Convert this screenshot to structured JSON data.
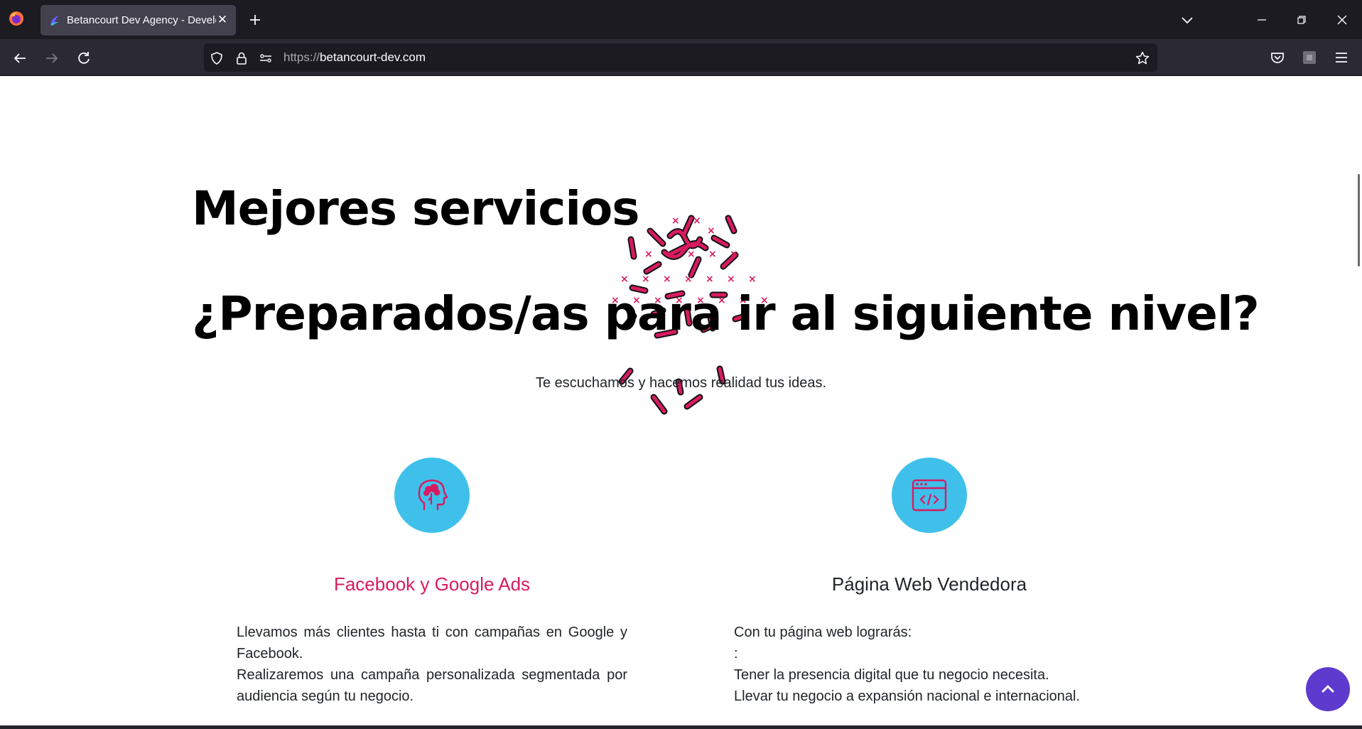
{
  "browser": {
    "tab_title": "Betancourt Dev Agency - Developers",
    "tab_close": "✕",
    "url_protocol": "https://",
    "url_host": "betancourt-dev.com"
  },
  "hero": {
    "heading_1": "Mejores servicios",
    "heading_2": "¿Preparados/as para ir al siguiente nivel?",
    "subtitle": "Te escuchamos y hacemos realidad tus ideas."
  },
  "services": [
    {
      "icon": "head-brain-icon",
      "title": "Facebook y Google Ads",
      "title_color": "#d81b60",
      "lines": [
        "Llevamos más clientes hasta ti con campañas en Google y Facebook.",
        "Realizaremos una campaña personalizada segmentada por audiencia según tu negocio."
      ]
    },
    {
      "icon": "browser-code-icon",
      "title": "Página Web Vendedora",
      "title_color": "#212529",
      "lines": [
        "Con tu página web lograrás:",
        ":",
        "Tener la presencia digital que tu negocio necesita.",
        "Llevar tu negocio a expansión nacional e internacional."
      ]
    }
  ],
  "colors": {
    "accent_pink": "#d81b60",
    "icon_circle": "#3fc0ea",
    "scroll_button": "#5e3bce",
    "chrome_dark": "#1c1b22",
    "chrome_toolbar": "#2b2a33"
  }
}
